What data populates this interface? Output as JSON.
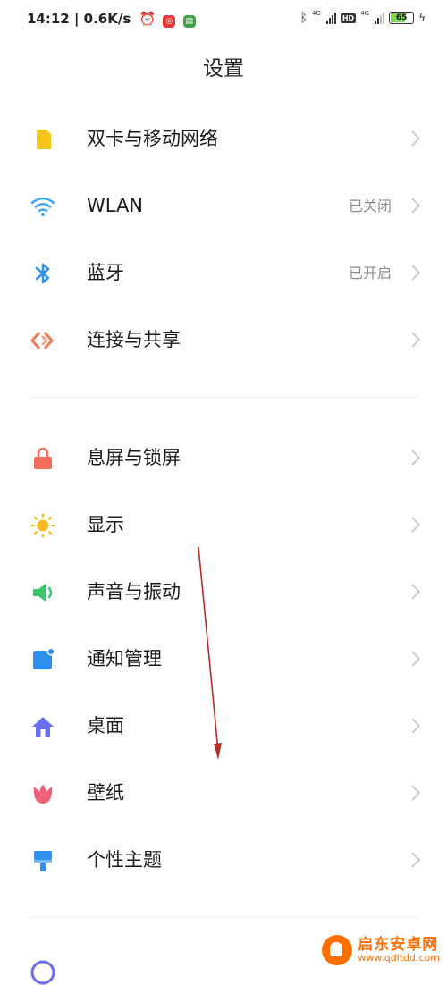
{
  "status_bar": {
    "time": "14:12 | 0.6K/s",
    "net_label_1": "4G",
    "net_label_2": "4G",
    "hd": "HD",
    "battery": "65"
  },
  "header": {
    "title": "设置"
  },
  "items": [
    {
      "label": "双卡与移动网络",
      "value": "",
      "icon": "sim-card-icon",
      "color": "#f5c518"
    },
    {
      "label": "WLAN",
      "value": "已关闭",
      "icon": "wifi-icon",
      "color": "#3ba8f5"
    },
    {
      "label": "蓝牙",
      "value": "已开启",
      "icon": "bluetooth-icon",
      "color": "#2f8ff0"
    },
    {
      "label": "连接与共享",
      "value": "",
      "icon": "share-icon",
      "color": "#f07a55"
    },
    {
      "label": "息屏与锁屏",
      "value": "",
      "icon": "lock-icon",
      "color": "#f26b5b"
    },
    {
      "label": "显示",
      "value": "",
      "icon": "sun-icon",
      "color": "#f7b924"
    },
    {
      "label": "声音与振动",
      "value": "",
      "icon": "speaker-icon",
      "color": "#3cc66c"
    },
    {
      "label": "通知管理",
      "value": "",
      "icon": "notification-icon",
      "color": "#2f8ff0"
    },
    {
      "label": "桌面",
      "value": "",
      "icon": "home-icon",
      "color": "#6b6ef0"
    },
    {
      "label": "壁纸",
      "value": "",
      "icon": "tulip-icon",
      "color": "#f0607a"
    },
    {
      "label": "个性主题",
      "value": "",
      "icon": "brush-icon",
      "color": "#2f8ff0"
    }
  ],
  "watermark": {
    "name": "启东安卓网",
    "url": "www.qdltdd.com"
  }
}
